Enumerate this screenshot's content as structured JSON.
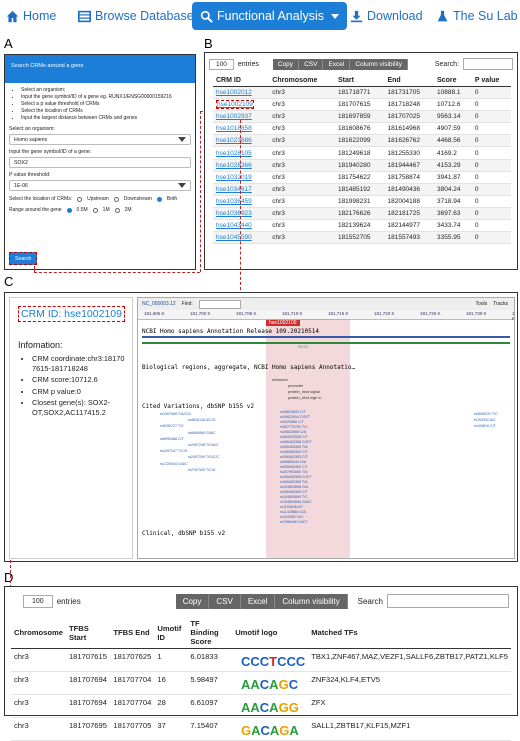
{
  "nav": {
    "home": "Home",
    "browse": "Browse Database",
    "functional": "Functional Analysis",
    "download": "Download",
    "lab": "The Su Lab"
  },
  "labels": {
    "a": "A",
    "b": "B",
    "c": "C",
    "d": "D"
  },
  "panel_a": {
    "header": "Search CRMs around a gene",
    "steps": [
      "Select an organism;",
      "Input the gene symbol/ID of a gene eg. RUNX1/ENSG00000159216",
      "Select a p value threshold of CRMs",
      "Select the location of CRMs",
      "Input the largest distance between CRMs and genes"
    ],
    "organism_label": "Select an organism:",
    "organism_value": "Homo sapiens",
    "gene_label": "Input the gene symbol/ID of a gene:",
    "gene_value": "SOX2",
    "pvalue_label": "P value threshold:",
    "pvalue_value": "1E-06",
    "location_label": "Select the location of CRMs:",
    "location_options": [
      "Upstream",
      "Downstream",
      "Both"
    ],
    "location_selected": "Both",
    "range_label": "Range around the gene",
    "range_options": [
      "0.5M",
      "1M",
      "2M"
    ],
    "range_selected": "0.5M",
    "search_button": "Search"
  },
  "panel_b": {
    "entries_value": "100",
    "entries_label": "entries",
    "buttons": [
      "Copy",
      "CSV",
      "Excel",
      "Column visibility"
    ],
    "search_label": "Search:",
    "columns": [
      "CRM ID",
      "Chromosome",
      "Start",
      "End",
      "Score",
      "P value"
    ],
    "rows": [
      [
        "hse1002012",
        "chr3",
        "181718771",
        "181731705",
        "10888.1",
        "0"
      ],
      [
        "hse1002109",
        "chr3",
        "181707615",
        "181718248",
        "10712.6",
        "0"
      ],
      [
        "hse1002937",
        "chr3",
        "181697859",
        "181707025",
        "9563.14",
        "0"
      ],
      [
        "hse1018858",
        "chr3",
        "181608676",
        "181614968",
        "4907.59",
        "0"
      ],
      [
        "hse1023686",
        "chr3",
        "181622099",
        "181626762",
        "4468.56",
        "0"
      ],
      [
        "hse1028105",
        "chr3",
        "181249618",
        "181255330",
        "4169.2",
        "0"
      ],
      [
        "hse1028366",
        "chr3",
        "181940280",
        "181944467",
        "4153.29",
        "0"
      ],
      [
        "hse1032019",
        "chr3",
        "181754622",
        "181758874",
        "3941.87",
        "0"
      ],
      [
        "hse1034617",
        "chr3",
        "181485192",
        "181490436",
        "3804.24",
        "0"
      ],
      [
        "hse1036459",
        "chr3",
        "181998231",
        "182004188",
        "3718.94",
        "0"
      ],
      [
        "hse1036923",
        "chr3",
        "182176626",
        "182181725",
        "3697.63",
        "0"
      ],
      [
        "hse1043440",
        "chr3",
        "182139624",
        "182144977",
        "3433.74",
        "0"
      ],
      [
        "hse1045590",
        "chr3",
        "181552705",
        "181557493",
        "3355.95",
        "0"
      ]
    ]
  },
  "panel_c": {
    "crm_id": "CRM ID: hse1002109",
    "info_heading": "Infomation:",
    "info_items": [
      "CRM coordinate:chr3:18170 7615-181718248",
      "CRM score:10712.6",
      "CRM p value:0",
      "Closest gene(s): SOX2-OT,SOX2,AC117415.2"
    ],
    "viewer": {
      "accession": "NC_000003.12",
      "find_label": "Find:",
      "tools_label": "Tools",
      "tracks_label": "Tracks",
      "highlight_tag": "hse1002109",
      "annotation_title": "NCBI Homo sapiens Annotation Release 109.20210514",
      "gene_label": "SOX2",
      "reg_title": "Biological regions, aggregate, NCBI Homo sapiens Annotatio…",
      "reg_items": [
        "enhancer",
        "promoter",
        "protein_bind signal",
        "protein_bind high m."
      ],
      "cited_title": "Cited Variations, dbSNP b155 v2",
      "clinical_title": "Clinical, dbSNP b155 v2",
      "ruler_ticks": [
        "181,695 K",
        "181,700 K",
        "181,705 K",
        "181,710 K",
        "181,715 K",
        "181,720 K",
        "181,725 K",
        "181,730 K",
        "181,735 K"
      ],
      "variants_left": [
        "rs1307068 T/A/C/G",
        "rs4834106 A/C/G",
        "rs9290727 T/C",
        "rs6846469 G/A/C",
        "rs6990468 C/T",
        "rs2497248 T/G/A/C",
        "rs2497247 T/C/G",
        "rs2497249 T/G/C/C",
        "rs1720044 G/A/C",
        "rs2767349 T/C/A"
      ],
      "variants_mid": [
        "rs39813693 C/T",
        "rs39823904 C/G/T",
        "rs9229568 C/T",
        "rs587776751 T/C",
        "rs39822565 C/A",
        "rs384093908 C/T",
        "rs306463308 C/G/T",
        "rs306463305 T/A",
        "rs306463304 C/T",
        "rs306463303 C/T",
        "rs99884044 G/A",
        "rs306463300 C/T",
        "rs307993060 T/A",
        "rs306463308 C/G/T",
        "rs306463306 T/A",
        "rs104893898 G/A",
        "rs306463309 C/T",
        "rs104893899 T/C",
        "rs104893898 G/A/C",
        "rs1194638 A/T",
        "rs11428684 G/A",
        "rs1043657 A/C",
        "rs7496446 G/A/T"
      ],
      "variants_right": [
        "rs3608231 T/C",
        "rs763932 A/C",
        "rs109810 C/T"
      ]
    }
  },
  "panel_d": {
    "entries_value": "100",
    "entries_label": "entries",
    "buttons": [
      "Copy",
      "CSV",
      "Excel",
      "Column visibility"
    ],
    "search_label": "Search",
    "columns": [
      "Chromosome",
      "TFBS Start",
      "TFBS End",
      "Umotif ID",
      "TF Binding Score",
      "Umotif logo",
      "Matched TFs"
    ],
    "rows": [
      [
        "chr3",
        "181707615",
        "181707625",
        "1",
        "6.01833",
        "CCCTCCC",
        "TBX1,ZNF467,MAZ,VEZF1,SALLF6,ZBTB17,PATZ1,KLF5"
      ],
      [
        "chr3",
        "181707694",
        "181707704",
        "16",
        "5.98497",
        "AACAGC",
        "ZNF324,KLF4,ETV5"
      ],
      [
        "chr3",
        "181707694",
        "181707704",
        "28",
        "6.61097",
        "AACAGG",
        "ZFX"
      ],
      [
        "chr3",
        "181707695",
        "181707705",
        "37",
        "7.15407",
        "GACAGA",
        "SALL1,ZBTB17,KLF15,MZF1"
      ]
    ]
  }
}
